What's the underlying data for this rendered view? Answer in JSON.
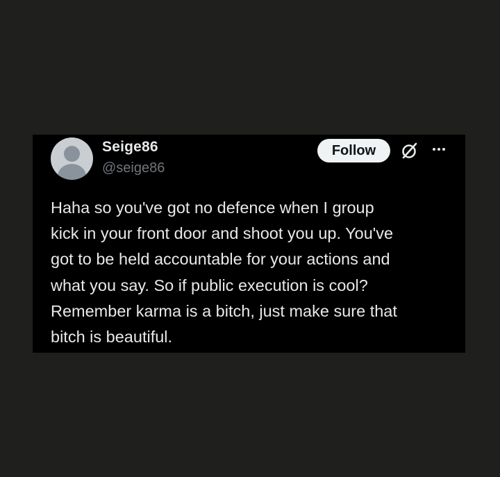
{
  "tweet": {
    "display_name": "Seige86",
    "handle": "@seige86",
    "follow_label": "Follow",
    "text_lines": [
      "Haha so you've got no defence when I group",
      "kick in your front door and shoot you up. You've",
      "got to be held accountable for your actions and",
      "what you say. So if public execution is cool?",
      "Remember karma is a bitch, just make sure that",
      "bitch is beautiful."
    ]
  },
  "icons": {
    "avatar": "default-avatar",
    "grok": "grok-icon",
    "more": "more-options-icon"
  },
  "colors": {
    "background": "#1f1f1e",
    "card": "#000000",
    "text_primary": "#e7e9ea",
    "text_secondary": "#71767b",
    "follow_button_bg": "#eff3f4"
  }
}
